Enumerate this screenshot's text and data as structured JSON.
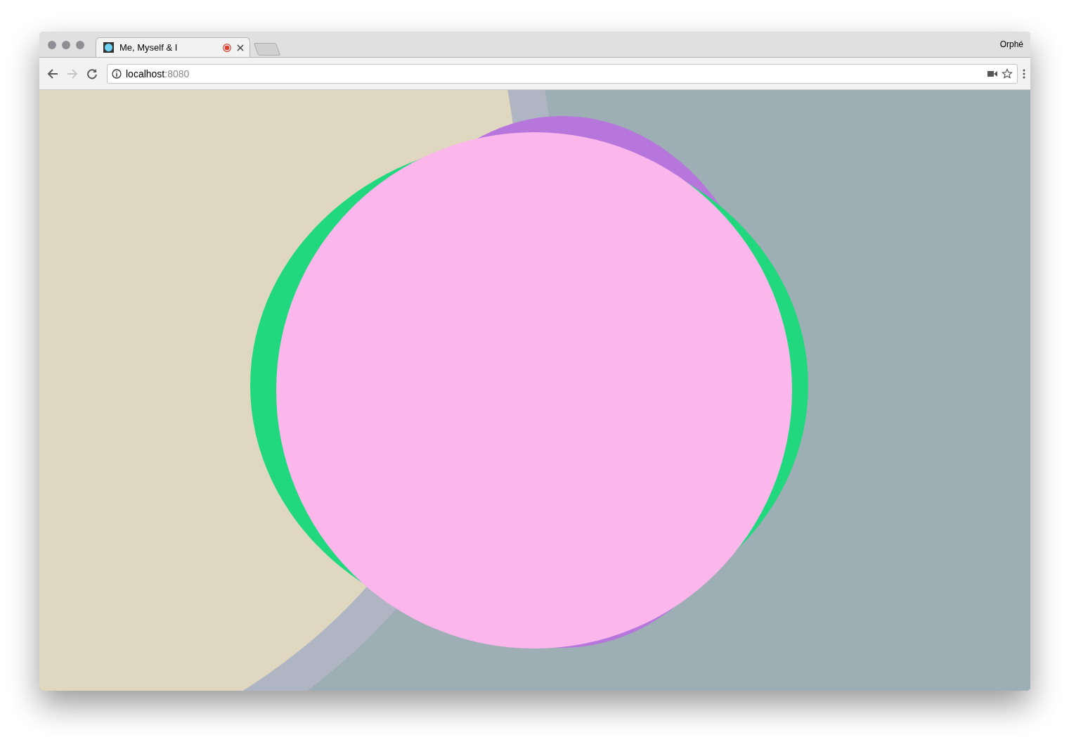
{
  "tabs": [
    {
      "title": "Me, Myself & I",
      "selected": true,
      "recording": true
    }
  ],
  "profile": "Orphé",
  "navigation": {
    "back": {
      "disabled": false
    },
    "forward": {
      "disabled": true
    }
  },
  "address_bar": {
    "host": "localhost",
    "port": ":8080"
  }
}
